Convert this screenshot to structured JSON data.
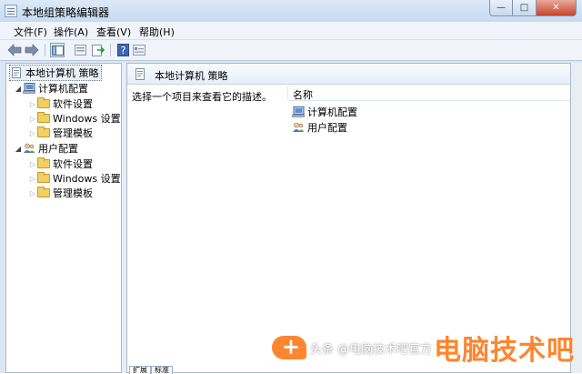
{
  "window": {
    "title": "本地组策略编辑器"
  },
  "menu": {
    "file": "文件(F)",
    "action": "操作(A)",
    "view": "查看(V)",
    "help": "帮助(H)"
  },
  "tree": {
    "root": "本地计算机 策略",
    "computer": {
      "label": "计算机配置",
      "children": [
        "软件设置",
        "Windows 设置",
        "管理模板"
      ]
    },
    "user": {
      "label": "用户配置",
      "children": [
        "软件设置",
        "Windows 设置",
        "管理模板"
      ]
    }
  },
  "details": {
    "header_title": "本地计算机 策略",
    "description": "选择一个项目来查看它的描述。",
    "column_name": "名称",
    "items": [
      "计算机配置",
      "用户配置"
    ]
  },
  "tabs": [
    "扩展",
    "标准"
  ],
  "watermark": {
    "small": "头条 @电脑技术吧官方",
    "big": "电脑技术吧"
  },
  "colors": {
    "accent": "#ff7a1a",
    "folder": "#f2cf62",
    "titlebar": "#c7daf0"
  },
  "icons": [
    "back-arrow-icon",
    "forward-arrow-icon",
    "console-tree-icon",
    "list-icon",
    "export-icon",
    "help-icon",
    "properties-icon",
    "folder-icon",
    "computer-icon",
    "users-icon",
    "policy-icon"
  ]
}
